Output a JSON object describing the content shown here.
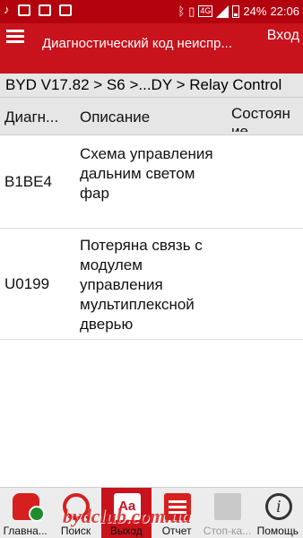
{
  "status_bar": {
    "battery": "24%",
    "time": "22:06",
    "network_type": "4G",
    "icons": [
      "music-note-icon",
      "image-icon",
      "sim-icon",
      "gallery-icon",
      "bluetooth-icon",
      "vibrate-icon",
      "signal-icon",
      "battery-icon"
    ]
  },
  "app_bar": {
    "title": "Диагностический код неиспр...",
    "exit_label": "Вход"
  },
  "breadcrumb": "BYD V17.82 > S6 >...DY  > Relay Control",
  "table": {
    "headers": [
      "Диагн...",
      "Описание",
      "Состоян ие"
    ],
    "rows": [
      {
        "code": "B1BE4",
        "description": "Схема управления дальним светом фар",
        "status": ""
      },
      {
        "code": "U0199",
        "description": "Потеряна связь с модулем управления мультиплексной дверью",
        "status": ""
      }
    ]
  },
  "toolbar": {
    "items": [
      {
        "label": "Главна...",
        "icon": "car-icon",
        "state": "normal"
      },
      {
        "label": "Поиск",
        "icon": "search-icon",
        "state": "normal"
      },
      {
        "label": "Выход",
        "icon": "exit-icon",
        "icon_text": "Aa",
        "state": "active"
      },
      {
        "label": "Отчет",
        "icon": "report-icon",
        "state": "normal"
      },
      {
        "label": "Стоп-ка...",
        "icon": "stop-icon",
        "state": "disabled"
      },
      {
        "label": "Помощь",
        "icon": "help-icon",
        "icon_text": "i",
        "state": "normal"
      }
    ]
  },
  "watermark": "bydclub.com.ua",
  "colors": {
    "status_bar": "#b3030e",
    "app_bar": "#c8121c",
    "header_bg": "#e6e6e6",
    "accent": "#d62020"
  }
}
